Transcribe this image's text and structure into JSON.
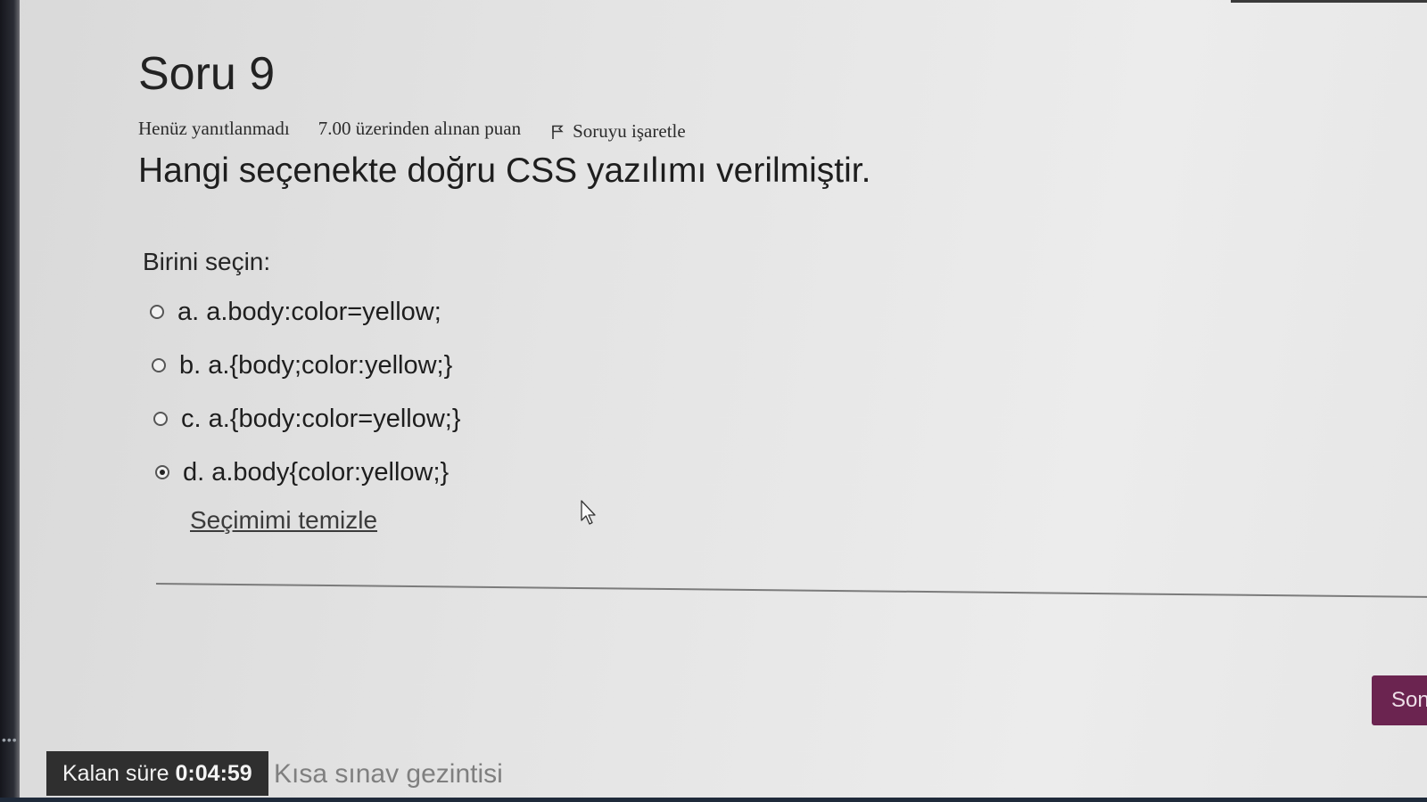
{
  "question": {
    "number": "Soru 9",
    "status": "Henüz yanıtlanmadı",
    "grade": "7.00 üzerinden alınan puan",
    "flag_label": "Soruyu işaretle",
    "flag_icon": "flag-icon",
    "text": "Hangi seçenekte doğru CSS yazılımı verilmiştir."
  },
  "prompt": "Birini seçin:",
  "answers": [
    {
      "label": "a. a.body:color=yellow;",
      "selected": false
    },
    {
      "label": "b. a.{body;color:yellow;}",
      "selected": false
    },
    {
      "label": "c. a.{body:color=yellow;}",
      "selected": false
    },
    {
      "label": "d. a.body{color:yellow;}",
      "selected": true
    }
  ],
  "clear_choice": "Seçimimi temizle",
  "next_button": "Son",
  "timer": {
    "label": "Kalan süre",
    "value": "0:04:59"
  },
  "quiz_navigation": "Kısa sınav gezintisi",
  "colors": {
    "accent": "#6b2450",
    "timer_bg": "#2f2f2f"
  }
}
